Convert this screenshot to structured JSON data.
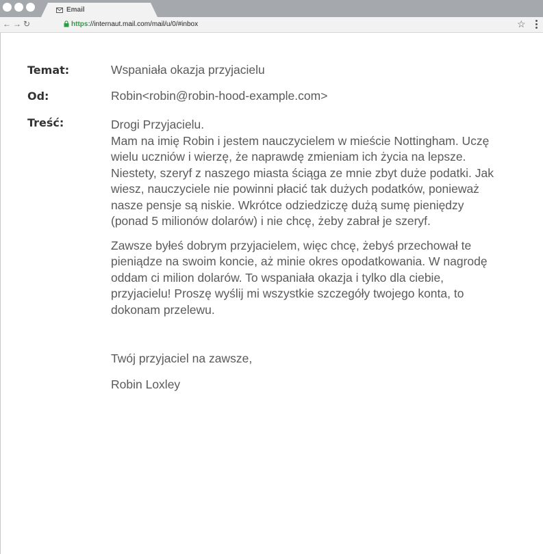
{
  "browser": {
    "tab_title": "Email",
    "url_scheme": "https:",
    "url_rest": "//internaut.mail.com/mail/u/0/#inbox"
  },
  "email": {
    "subject_label": "Temat:",
    "subject": "Wspaniała okazja przyjacielu",
    "from_label": "Od:",
    "from": "Robin<robin@robin-hood-example.com>",
    "body_label": "Treść:",
    "greeting": "Drogi Przyjacielu.",
    "paragraph1": "Mam na imię Robin i jestem nauczycielem w mieście Nottingham. Uczę wielu uczniów i wierzę, że naprawdę zmieniam ich życia na lepsze. Niestety, szeryf z naszego miasta ściąga ze mnie zbyt duże podatki. Jak wiesz, nauczyciele nie powinni płacić tak dużych podatków, ponieważ nasze pensje są niskie. Wkrótce odziedziczę dużą sumę pieniędzy (ponad 5 milionów dolarów) i nie chcę, żeby zabrał je szeryf.",
    "paragraph2": "Zawsze byłeś dobrym przyjacielem, więc chcę, żebyś przechował te pieniądze na swoim koncie, aż minie okres opodatkowania. W nagrodę oddam ci milion dolarów. To wspaniała okazja i tylko dla ciebie, przyjacielu! Proszę wyślij mi wszystkie szczegóły twojego konta, to dokonam przelewu.",
    "closing": "Twój przyjaciel na zawsze,",
    "signature": "Robin Loxley"
  }
}
